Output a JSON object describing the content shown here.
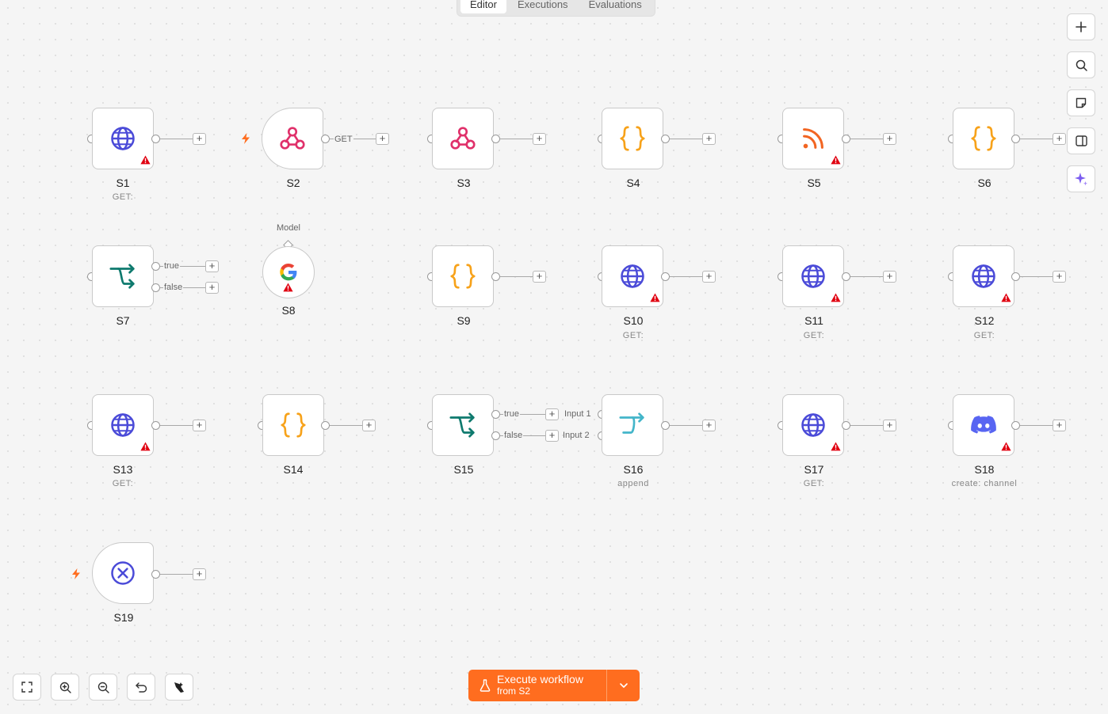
{
  "tabs": [
    "Editor",
    "Executions",
    "Evaluations"
  ],
  "colors": {
    "accent": "#ff6d1f",
    "http_icon": "#4b4bd8",
    "webhook_icon": "#e0306a",
    "code_icon": "#f7a21a",
    "if_icon": "#0f7a6e",
    "rss_icon": "#f26522",
    "merge_icon": "#43b5c9",
    "discord_icon": "#5865f2",
    "warning": "#e00010"
  },
  "nodes": [
    {
      "name": "S1",
      "subtitle": "GET:",
      "icon": "globe-icon",
      "warning": true
    },
    {
      "name": "S2",
      "subtitle": "",
      "icon": "webhook-icon",
      "warning": false,
      "trigger": true
    },
    {
      "name": "S3",
      "subtitle": "",
      "icon": "webhook-icon",
      "warning": false
    },
    {
      "name": "S4",
      "subtitle": "",
      "icon": "code-braces-icon",
      "warning": false
    },
    {
      "name": "S5",
      "subtitle": "",
      "icon": "rss-icon",
      "warning": true
    },
    {
      "name": "S6",
      "subtitle": "",
      "icon": "code-braces-icon",
      "warning": false
    },
    {
      "name": "S7",
      "subtitle": "",
      "icon": "if-branch-icon",
      "warning": false
    },
    {
      "name": "S8",
      "subtitle": "",
      "icon": "google-icon",
      "warning": true,
      "sub_label": "Model"
    },
    {
      "name": "S9",
      "subtitle": "",
      "icon": "code-braces-icon",
      "warning": false
    },
    {
      "name": "S10",
      "subtitle": "GET:",
      "icon": "globe-icon",
      "warning": true
    },
    {
      "name": "S11",
      "subtitle": "GET:",
      "icon": "globe-icon",
      "warning": true
    },
    {
      "name": "S12",
      "subtitle": "GET:",
      "icon": "globe-icon",
      "warning": true
    },
    {
      "name": "S13",
      "subtitle": "GET:",
      "icon": "globe-icon",
      "warning": true
    },
    {
      "name": "S14",
      "subtitle": "",
      "icon": "code-braces-icon",
      "warning": false
    },
    {
      "name": "S15",
      "subtitle": "",
      "icon": "if-branch-icon",
      "warning": false
    },
    {
      "name": "S16",
      "subtitle": "append",
      "icon": "merge-icon",
      "warning": false
    },
    {
      "name": "S17",
      "subtitle": "GET:",
      "icon": "globe-icon",
      "warning": true
    },
    {
      "name": "S18",
      "subtitle": "create: channel",
      "icon": "discord-icon",
      "warning": true
    },
    {
      "name": "S19",
      "subtitle": "",
      "icon": "x-circle-icon",
      "warning": false,
      "trigger": true
    }
  ],
  "edge_labels": {
    "get": "GET",
    "true": "true",
    "false": "false",
    "input1": "Input 1",
    "input2": "Input 2"
  },
  "side_toolbar": [
    "plus-icon",
    "search-icon",
    "sticky-note-icon",
    "panel-icon",
    "sparkle-icon"
  ],
  "bottom_toolbar": [
    "fit-view-icon",
    "zoom-in-icon",
    "zoom-out-icon",
    "undo-icon",
    "tidy-up-icon"
  ],
  "execute": {
    "title": "Execute workflow",
    "subtitle": "from S2"
  }
}
